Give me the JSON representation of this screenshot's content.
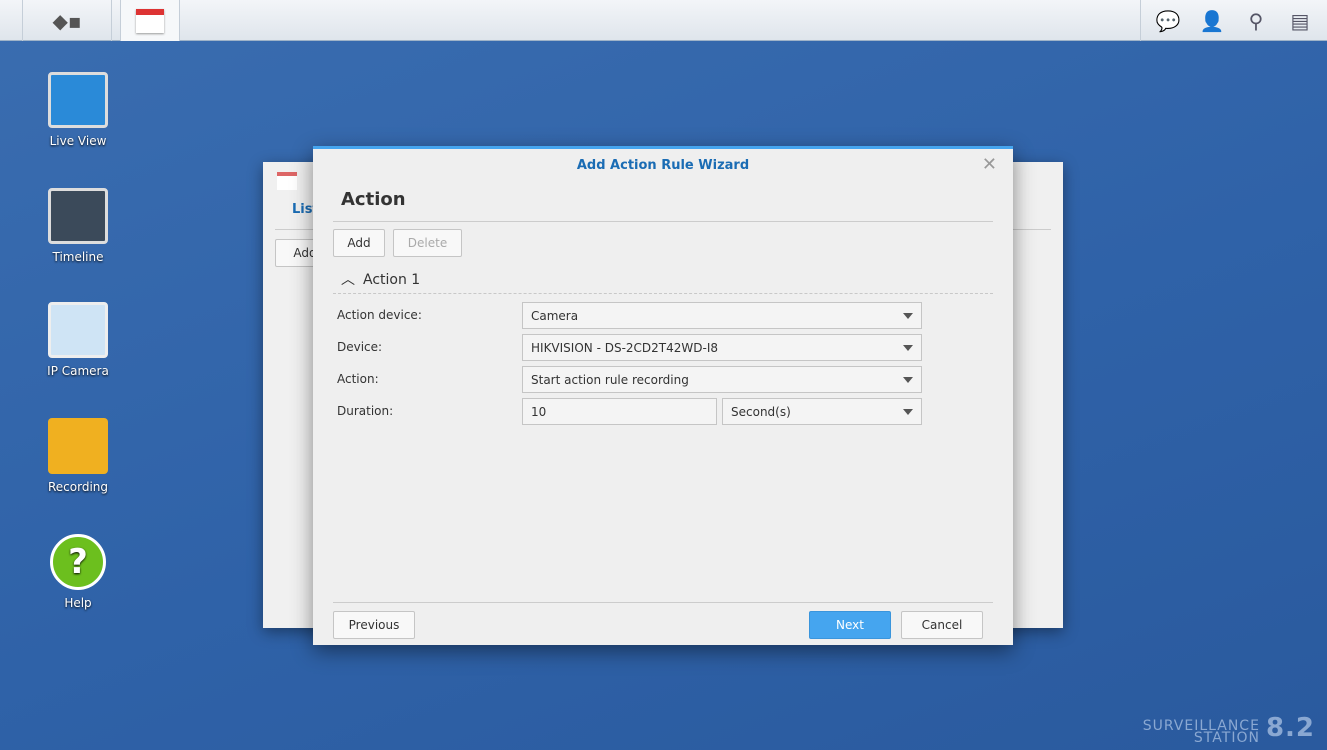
{
  "taskbar": {
    "main_menu_icon": "main-menu-icon",
    "app_icon": "action-rule-icon",
    "right_icons": [
      "chat-icon",
      "user-icon",
      "search-icon",
      "widgets-icon"
    ]
  },
  "desktop": [
    {
      "label": "Live View"
    },
    {
      "label": "Timeline"
    },
    {
      "label": "IP Camera"
    },
    {
      "label": "Recording"
    },
    {
      "label": "Help"
    }
  ],
  "background_window": {
    "tab": "List",
    "add": "Add"
  },
  "dialog": {
    "title": "Add Action Rule Wizard",
    "heading": "Action",
    "add": "Add",
    "delete": "Delete",
    "section": "Action 1",
    "fields": {
      "action_device_label": "Action device:",
      "action_device": "Camera",
      "device_label": "Device:",
      "device": "HIKVISION - DS-2CD2T42WD-I8",
      "action_label": "Action:",
      "action": "Start action rule recording",
      "duration_label": "Duration:",
      "duration": "10",
      "duration_unit": "Second(s)"
    },
    "previous": "Previous",
    "next": "Next",
    "cancel": "Cancel"
  },
  "brand": {
    "line1": "SURVEILLANCE",
    "line2": "STATION",
    "version": "8.2"
  },
  "colors": {
    "accent": "#45a5ef",
    "title": "#1a6cb4"
  }
}
